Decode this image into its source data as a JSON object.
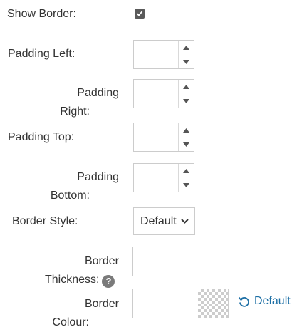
{
  "show_border": {
    "label": "Show Border:",
    "checked": true
  },
  "padding_left": {
    "label": "Padding Left:",
    "value": ""
  },
  "padding_right": {
    "label_line1": "Padding",
    "label_line2": "Right:",
    "value": ""
  },
  "padding_top": {
    "label": "Padding Top:",
    "value": ""
  },
  "padding_bottom": {
    "label_line1": "Padding",
    "label_line2": "Bottom:",
    "value": ""
  },
  "border_style": {
    "label": "Border Style:",
    "selected": "Default"
  },
  "border_thickness": {
    "label_line1": "Border",
    "label_line2": "Thickness:",
    "help_symbol": "?",
    "value": ""
  },
  "border_colour": {
    "label_line1": "Border",
    "label_line2": "Colour:",
    "value": "",
    "reset_label": "Default"
  },
  "colors": {
    "text": "#333333",
    "link": "#1d6fa5",
    "border": "#cccccc",
    "checkbox": "#5a5a5a"
  },
  "icons": [
    "check-icon",
    "spin-up-icon",
    "spin-down-icon",
    "chevron-down-icon",
    "help-icon",
    "reset-icon"
  ]
}
